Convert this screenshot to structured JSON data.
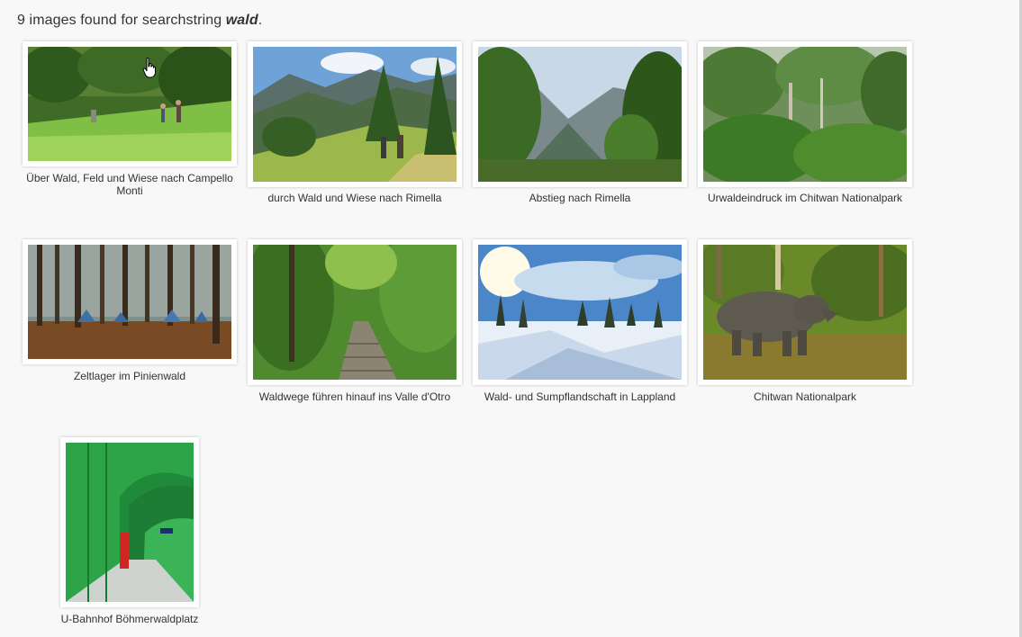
{
  "header": {
    "prefix": "9 images found for searchstring",
    "term": "wald",
    "suffix": "."
  },
  "results": [
    {
      "caption": "Über Wald, Feld und Wiese nach Campello Monti"
    },
    {
      "caption": "durch Wald und Wiese nach Rimella"
    },
    {
      "caption": "Abstieg nach Rimella"
    },
    {
      "caption": "Urwaldeindruck im Chitwan Nationalpark"
    },
    {
      "caption": "Zeltlager im Pinienwald"
    },
    {
      "caption": "Waldwege führen hinauf ins Valle d'Otro"
    },
    {
      "caption": "Wald- und Sumpflandschaft in Lappland"
    },
    {
      "caption": "Chitwan Nationalpark"
    },
    {
      "caption": "U-Bahnhof Böhmerwaldplatz"
    }
  ]
}
